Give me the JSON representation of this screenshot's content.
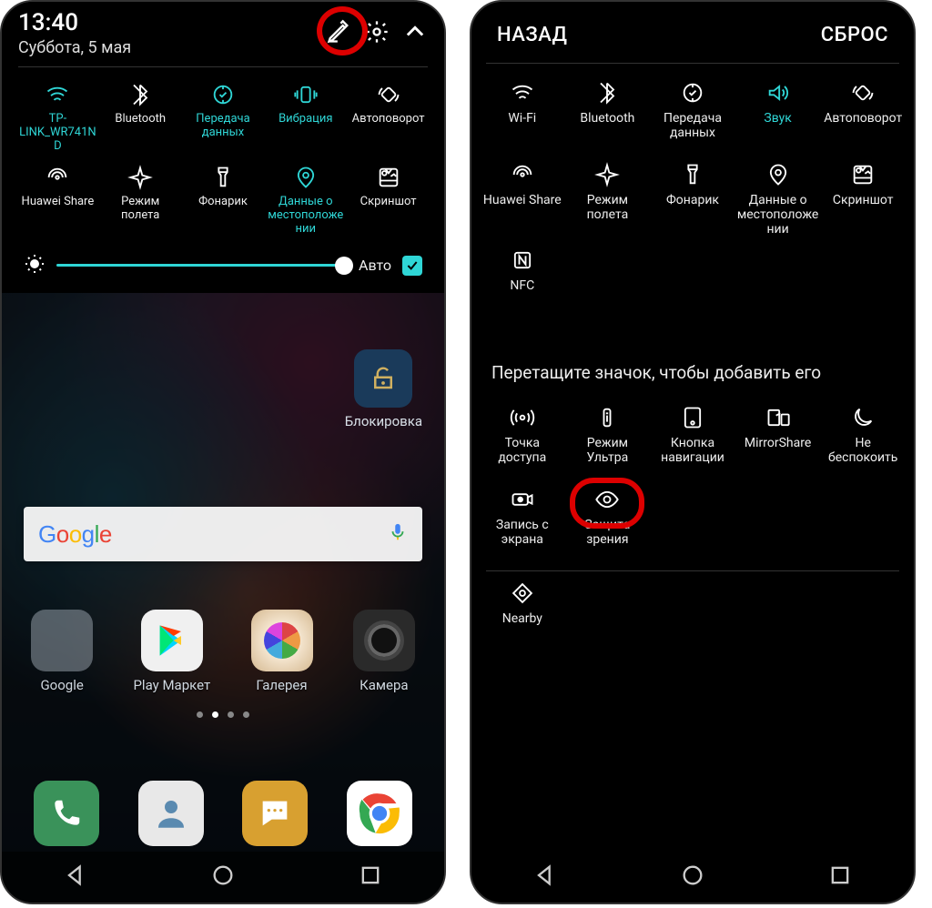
{
  "left": {
    "time": "13:40",
    "date": "Суббота, 5 мая",
    "auto_label": "Авто",
    "tiles_row1": [
      {
        "label": "TP-LINK_WR741ND",
        "active": true,
        "icon": "wifi"
      },
      {
        "label": "Bluetooth",
        "active": false,
        "icon": "bluetooth"
      },
      {
        "label": "Передача данных",
        "active": true,
        "icon": "data"
      },
      {
        "label": "Вибрация",
        "active": true,
        "icon": "vibration"
      },
      {
        "label": "Автоповорот",
        "active": false,
        "icon": "rotate"
      }
    ],
    "tiles_row2": [
      {
        "label": "Huawei Share",
        "active": false,
        "icon": "share"
      },
      {
        "label": "Режим полета",
        "active": false,
        "icon": "airplane"
      },
      {
        "label": "Фонарик",
        "active": false,
        "icon": "flashlight"
      },
      {
        "label": "Данные о местоположении",
        "active": true,
        "icon": "location"
      },
      {
        "label": "Скриншот",
        "active": false,
        "icon": "screenshot"
      }
    ],
    "lock_widget_label": "Блокировка",
    "apps": [
      {
        "label": "Google",
        "icon": "folder"
      },
      {
        "label": "Play Маркет",
        "icon": "play"
      },
      {
        "label": "Галерея",
        "icon": "gallery"
      },
      {
        "label": "Камера",
        "icon": "camera"
      }
    ]
  },
  "right": {
    "back": "НАЗАД",
    "reset": "СБРОС",
    "tiles_active": [
      {
        "label": "Wi-Fi",
        "icon": "wifi"
      },
      {
        "label": "Bluetooth",
        "icon": "bluetooth"
      },
      {
        "label": "Передача данных",
        "icon": "data"
      },
      {
        "label": "Звук",
        "icon": "sound",
        "active": true
      },
      {
        "label": "Автоповорот",
        "icon": "rotate"
      },
      {
        "label": "Huawei Share",
        "icon": "share"
      },
      {
        "label": "Режим полета",
        "icon": "airplane"
      },
      {
        "label": "Фонарик",
        "icon": "flashlight"
      },
      {
        "label": "Данные о местоположении",
        "icon": "location"
      },
      {
        "label": "Скриншот",
        "icon": "screenshot"
      },
      {
        "label": "NFC",
        "icon": "nfc"
      }
    ],
    "instruction": "Перетащите значок, чтобы добавить его",
    "tiles_available": [
      {
        "label": "Точка доступа",
        "icon": "hotspot"
      },
      {
        "label": "Режим Ультра",
        "icon": "ultra"
      },
      {
        "label": "Кнопка навигации",
        "icon": "navbutton"
      },
      {
        "label": "MirrorShare",
        "icon": "mirror"
      },
      {
        "label": "Не беспокоить",
        "icon": "dnd"
      },
      {
        "label": "Запись с экрана",
        "icon": "record"
      },
      {
        "label": "Защита зрения",
        "icon": "eye",
        "highlight": true
      },
      {
        "label": "",
        "icon": ""
      },
      {
        "label": "",
        "icon": ""
      },
      {
        "label": "",
        "icon": ""
      },
      {
        "label": "Nearby",
        "icon": "nearby"
      }
    ]
  }
}
